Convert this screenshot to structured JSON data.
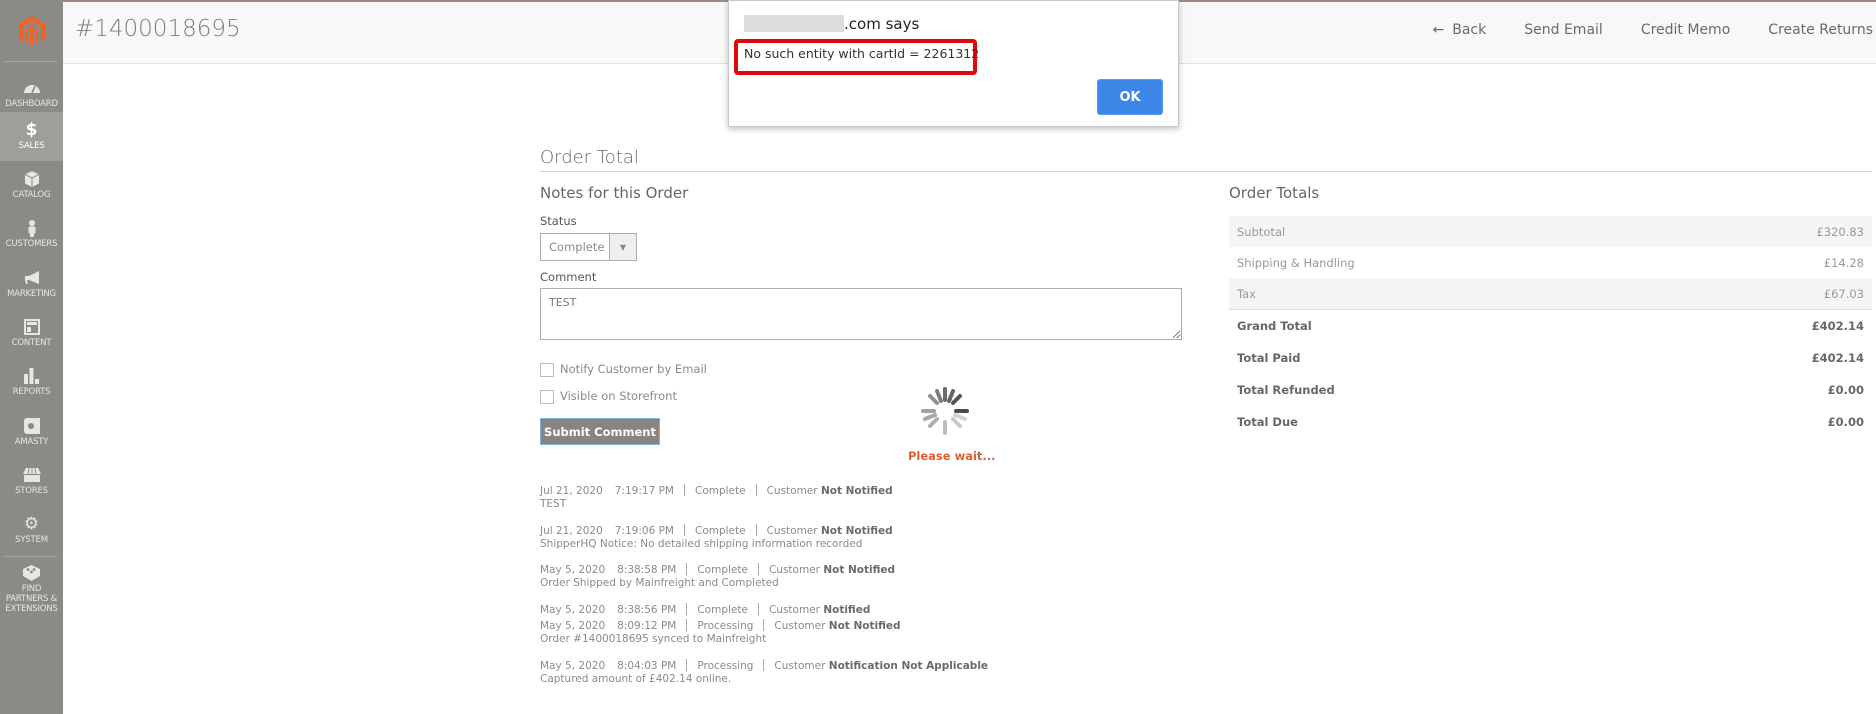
{
  "sidebar": {
    "items": [
      {
        "label": "Dashboard",
        "icon": "gauge-icon"
      },
      {
        "label": "Sales",
        "icon": "dollar-icon",
        "active": true
      },
      {
        "label": "Catalog",
        "icon": "box-icon"
      },
      {
        "label": "Customers",
        "icon": "person-icon"
      },
      {
        "label": "Marketing",
        "icon": "megaphone-icon"
      },
      {
        "label": "Content",
        "icon": "layout-icon"
      },
      {
        "label": "Reports",
        "icon": "bar-chart-icon"
      },
      {
        "label": "Amasty",
        "icon": "amasty-icon"
      },
      {
        "label": "Stores",
        "icon": "storefront-icon"
      },
      {
        "label": "System",
        "icon": "gear-icon"
      },
      {
        "label": "Find Partners & Extensions",
        "icon": "bricks-icon"
      }
    ]
  },
  "header": {
    "title": "#1400018695",
    "actions": {
      "back": "Back",
      "send_email": "Send Email",
      "credit_memo": "Credit Memo",
      "create_returns": "Create Returns"
    }
  },
  "dialog": {
    "title_suffix": ".com says",
    "message": "No such entity with cartId = 2261312",
    "ok_label": "OK"
  },
  "order_total": {
    "section_title": "Order Total",
    "notes": {
      "title": "Notes for this Order",
      "status_label": "Status",
      "status_value": "Complete",
      "comment_label": "Comment",
      "comment_value": "TEST",
      "notify_label": "Notify Customer by Email",
      "visible_label": "Visible on Storefront",
      "submit_label": "Submit Comment"
    },
    "loader_text": "Please wait...",
    "history": [
      {
        "date": "Jul 21, 2020",
        "time": "7:19:17 PM",
        "status": "Complete",
        "customer_label": "Customer",
        "notified": "Not Notified",
        "comment": "TEST"
      },
      {
        "date": "Jul 21, 2020",
        "time": "7:19:06 PM",
        "status": "Complete",
        "customer_label": "Customer",
        "notified": "Not Notified",
        "comment": "ShipperHQ Notice: No detailed shipping information recorded"
      },
      {
        "date": "May 5, 2020",
        "time": "8:38:58 PM",
        "status": "Complete",
        "customer_label": "Customer",
        "notified": "Not Notified",
        "comment": "Order Shipped by Mainfreight and Completed"
      },
      {
        "date": "May 5, 2020",
        "time": "8:38:56 PM",
        "status": "Complete",
        "customer_label": "Customer",
        "notified": "Notified",
        "comment": ""
      },
      {
        "date": "May 5, 2020",
        "time": "8:09:12 PM",
        "status": "Processing",
        "customer_label": "Customer",
        "notified": "Not Notified",
        "comment": "Order #1400018695 synced to Mainfreight"
      },
      {
        "date": "May 5, 2020",
        "time": "8:04:03 PM",
        "status": "Processing",
        "customer_label": "Customer",
        "notified": "Notification Not Applicable",
        "comment": "Captured amount of £402.14 online."
      }
    ],
    "totals": {
      "title": "Order Totals",
      "rows": [
        {
          "label": "Subtotal",
          "value": "£320.83"
        },
        {
          "label": "Shipping & Handling",
          "value": "£14.28"
        },
        {
          "label": "Tax",
          "value": "£67.03"
        },
        {
          "label": "Grand Total",
          "value": "£402.14"
        },
        {
          "label": "Total Paid",
          "value": "£402.14"
        },
        {
          "label": "Total Refunded",
          "value": "£0.00"
        },
        {
          "label": "Total Due",
          "value": "£0.00"
        }
      ]
    }
  },
  "colors": {
    "sidebar_bg": "#8c8a87",
    "accent_orange": "#e35d2f",
    "ok_blue": "#3d87e8",
    "highlight_red": "#e0070d"
  }
}
